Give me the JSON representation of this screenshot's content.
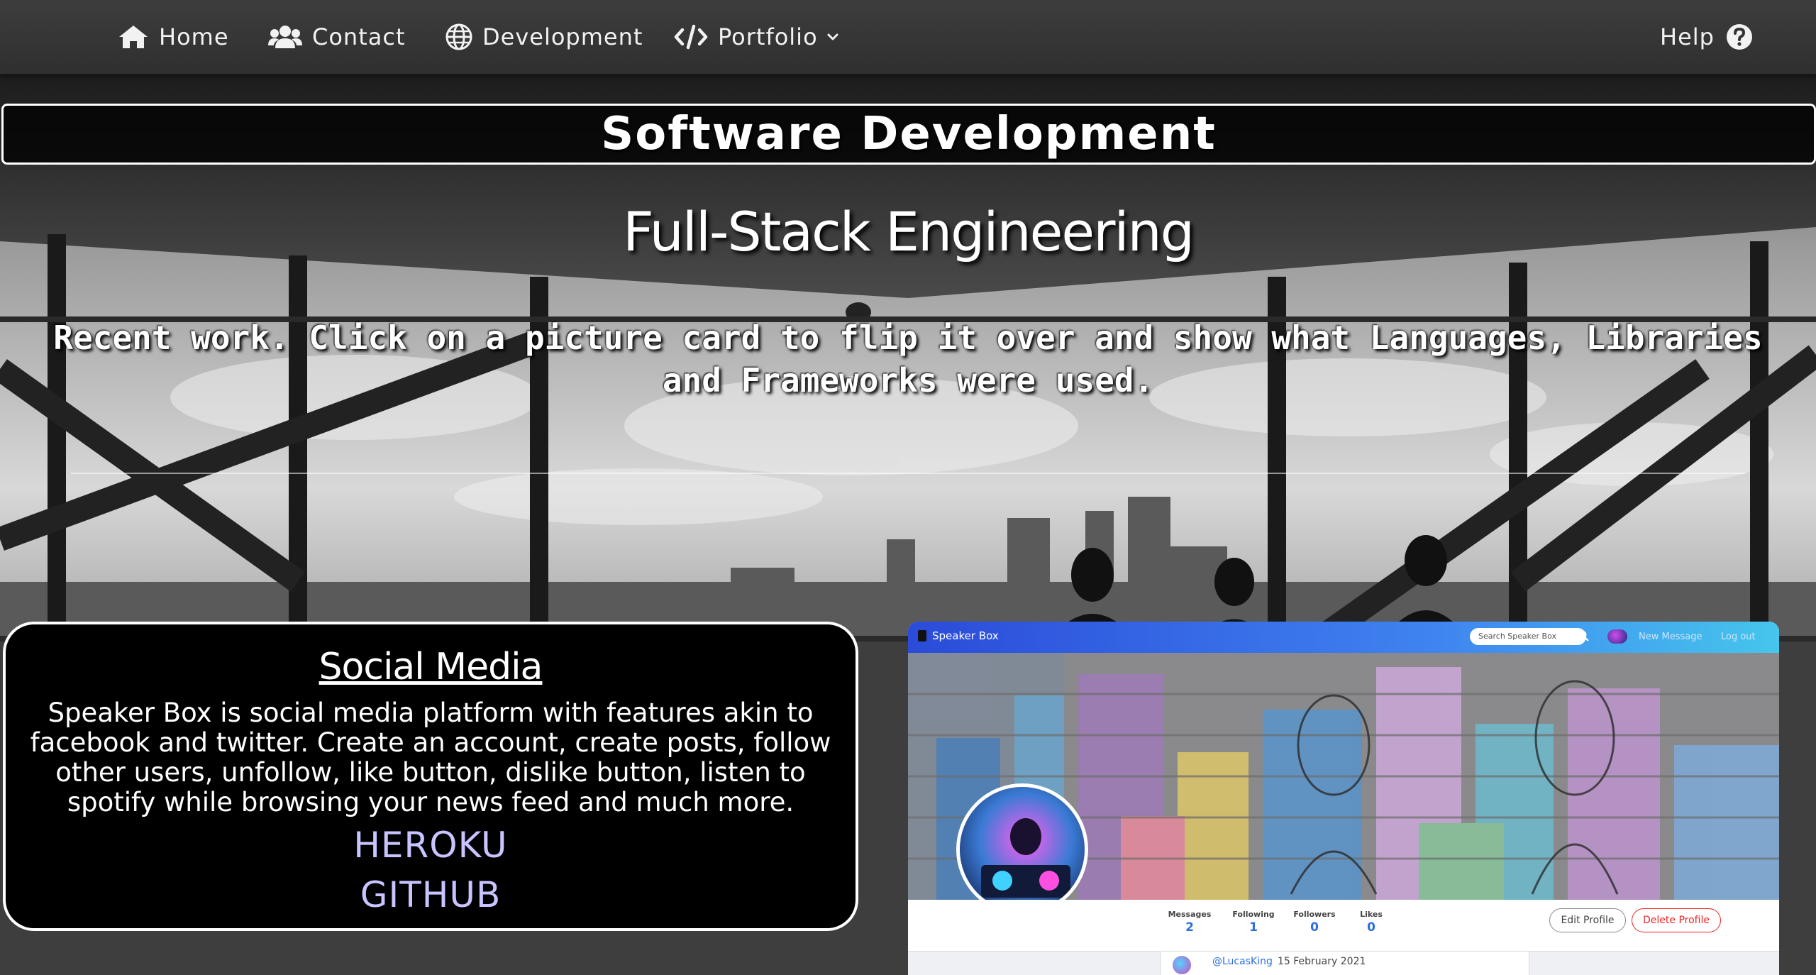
{
  "nav": {
    "home": "Home",
    "contact": "Contact",
    "development": "Development",
    "portfolio": "Portfolio",
    "help": "Help",
    "icons": [
      "home-icon",
      "users-icon",
      "globe-icon",
      "code-icon",
      "chevron-down-icon",
      "question-circle-icon"
    ]
  },
  "page": {
    "banner": "Software Development",
    "subtitle": "Full-Stack Engineering",
    "intro": "Recent work. Click on a picture card to flip it over and show what Languages, Libraries and Frameworks were used."
  },
  "card": {
    "title": "Social Media",
    "description": "Speaker Box is social media platform with features akin to facebook and twitter. Create an account, create posts, follow other users, unfollow, like button, dislike button, listen to spotify while browsing your news feed and much more.",
    "heroku": "HEROKU",
    "github": "GITHUB"
  },
  "preview": {
    "brand": "Speaker Box",
    "search_placeholder": "Search Speaker Box",
    "new_message": "New Message",
    "logout": "Log out",
    "stats": [
      {
        "label": "Messages",
        "value": "2"
      },
      {
        "label": "Following",
        "value": "1"
      },
      {
        "label": "Followers",
        "value": "0"
      },
      {
        "label": "Likes",
        "value": "0"
      }
    ],
    "edit_profile": "Edit Profile",
    "delete_profile": "Delete Profile",
    "post_user": "@LucasKing",
    "post_date": "15 February 2021"
  },
  "colors": {
    "navbar": "#353535",
    "link": "#c8c4ff",
    "preview_bar": "#3f83f0",
    "delete": "#e22222"
  }
}
